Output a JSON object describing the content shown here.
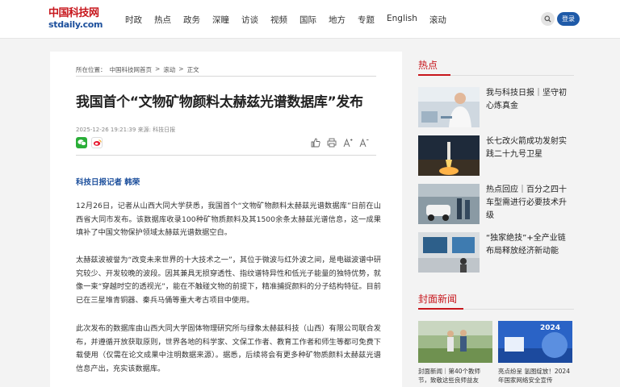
{
  "header": {
    "logo_cn": "中国科技网",
    "logo_en": "stdaily.com",
    "nav": [
      "时政",
      "热点",
      "政务",
      "深瞳",
      "访谈",
      "视频",
      "国际",
      "地方",
      "专题",
      "English",
      "滚动"
    ],
    "login_label": "登录"
  },
  "article": {
    "breadcrumb": {
      "prefix": "所在位置：",
      "home": "中国科技网首页",
      "sep1": ">",
      "channel": "滚动",
      "sep2": ">",
      "current": "正文"
    },
    "title": "我国首个“文物矿物颜料太赫兹光谱数据库”发布",
    "meta": "2025-12-26 19:21:39 来源: 科技日报",
    "reporter": "科技日报记者 韩荣",
    "paragraphs": [
      "12月26日，记者从山西大同大学获悉，我国首个“文物矿物颜料太赫兹光谱数据库”日前在山西省大同市发布。该数据库收录100种矿物质颜料及其1500余条太赫兹光谱信息，这一成果填补了中国文物保护领域太赫兹光谱数据空白。",
      "太赫兹波被誉为“改变未来世界的十大技术之一”，其位于微波与红外波之间，是电磁波谱中研究较少、开发较晚的波段。因其兼具无损穿透性、指纹谱特异性和低光子能量的独特优势，就像一束“穿越时空的透视光”，能在不触碰文物的前提下，精准捕捉颜料的分子结构特征。目前已在三星堆青铜器、秦兵马俑等重大考古项目中使用。",
      "此次发布的数据库由山西大同大学固体物理研究所与绿象太赫兹科技（山西）有限公司联合发布，并遵循开放获取原则，世界各地的科学家、文保工作者、教育工作者和师生等都可免费下载使用（仅需在论文成果中注明数据来源）。据悉，后续将会有更多种矿物质颜料太赫兹光谱信息产出，充实该数据库。"
    ]
  },
  "sidebar": {
    "hot_title": "热点",
    "hot_items": [
      "我与科技日报｜坚守初心炼真金",
      "长七改火箭成功发射实践二十九号卫星",
      "热点回应｜百分之四十车型需进行必要技术升级",
      "“独家绝技”+全产业链布局释放经济新动能"
    ],
    "cover_title": "封面新闻",
    "cover_items": [
      "封面新闻｜第40个教师节，致敬这些良师益友",
      "亮点纷呈 氢图绽放！2024年国家网络安全宣传"
    ],
    "cover_badge": "2024"
  }
}
